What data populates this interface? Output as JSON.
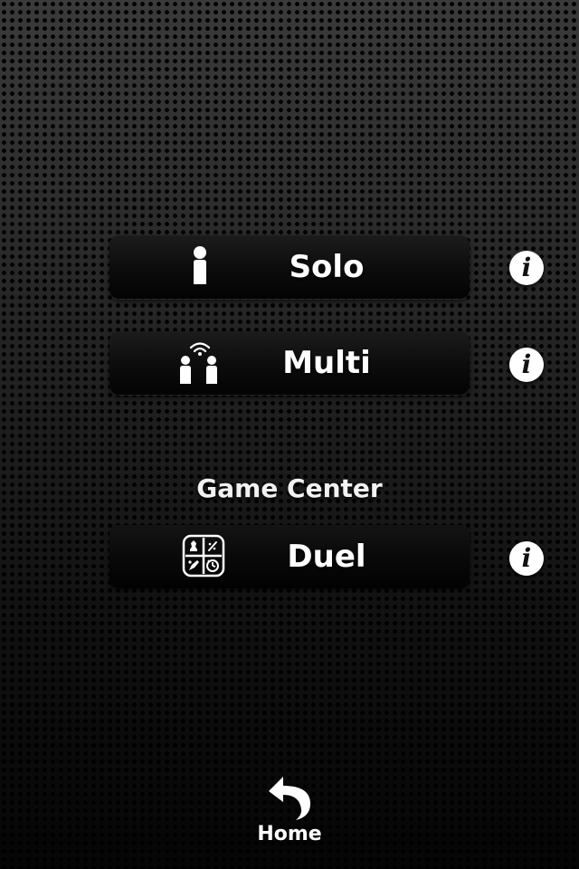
{
  "menu": {
    "solo": {
      "label": "Solo",
      "icon": "single-player-icon"
    },
    "multi": {
      "label": "Multi",
      "icon": "multiplayer-wifi-icon"
    }
  },
  "game_center": {
    "title": "Game Center",
    "duel": {
      "label": "Duel",
      "icon": "game-center-grid-icon"
    }
  },
  "info": {
    "glyph": "i",
    "icon": "info-icon"
  },
  "nav": {
    "home_label": "Home",
    "icon": "back-arrow-icon"
  },
  "colors": {
    "background": "#1e1e1e",
    "button": "#0d0d0d",
    "text": "#ffffff",
    "info_circle": "#ffffff"
  }
}
